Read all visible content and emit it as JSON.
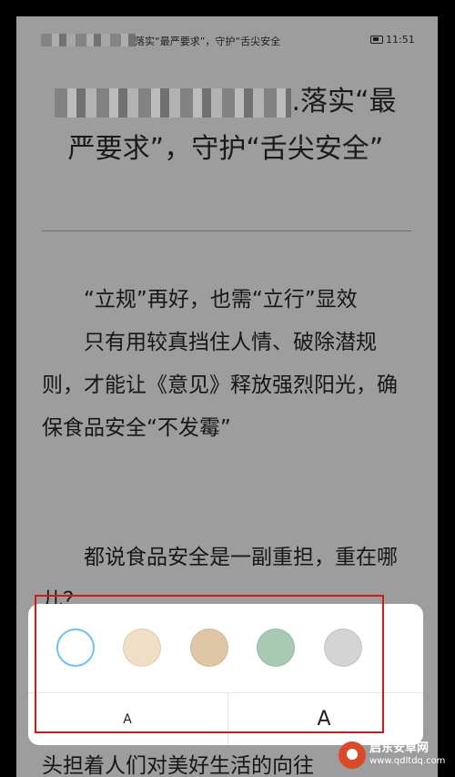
{
  "status_bar": {
    "title": "落实“最严要求”，守护“舌尖安全",
    "time": "11:51"
  },
  "article": {
    "headline_end": ".落实“最严要求”，守护“舌尖安全”",
    "subheading": "“立规”再好，也需“立行”显效",
    "paragraph1": "只有用较真挡住人情、破除潜规则，才能让《意见》释放强烈阳光，确保食品安全“不发霉”",
    "paragraph2": "都说食品安全是一副重担，重在哪儿？",
    "cut_off_line": "头担着人们对美好生活的向往"
  },
  "reading_settings": {
    "background_swatches": [
      {
        "name": "white",
        "color": "#ffffff",
        "selected": true
      },
      {
        "name": "beige",
        "color": "#f0dfc6",
        "selected": false
      },
      {
        "name": "tan",
        "color": "#dfc7a6",
        "selected": false
      },
      {
        "name": "green",
        "color": "#a8c9b2",
        "selected": false
      },
      {
        "name": "gray",
        "color": "#d4d4d4",
        "selected": false
      }
    ],
    "font_smaller_label": "A",
    "font_larger_label": "A",
    "highlight_color": "#d01a1a"
  },
  "watermark": {
    "name": "启东安卓网",
    "url": "www.qdltdq.com"
  }
}
